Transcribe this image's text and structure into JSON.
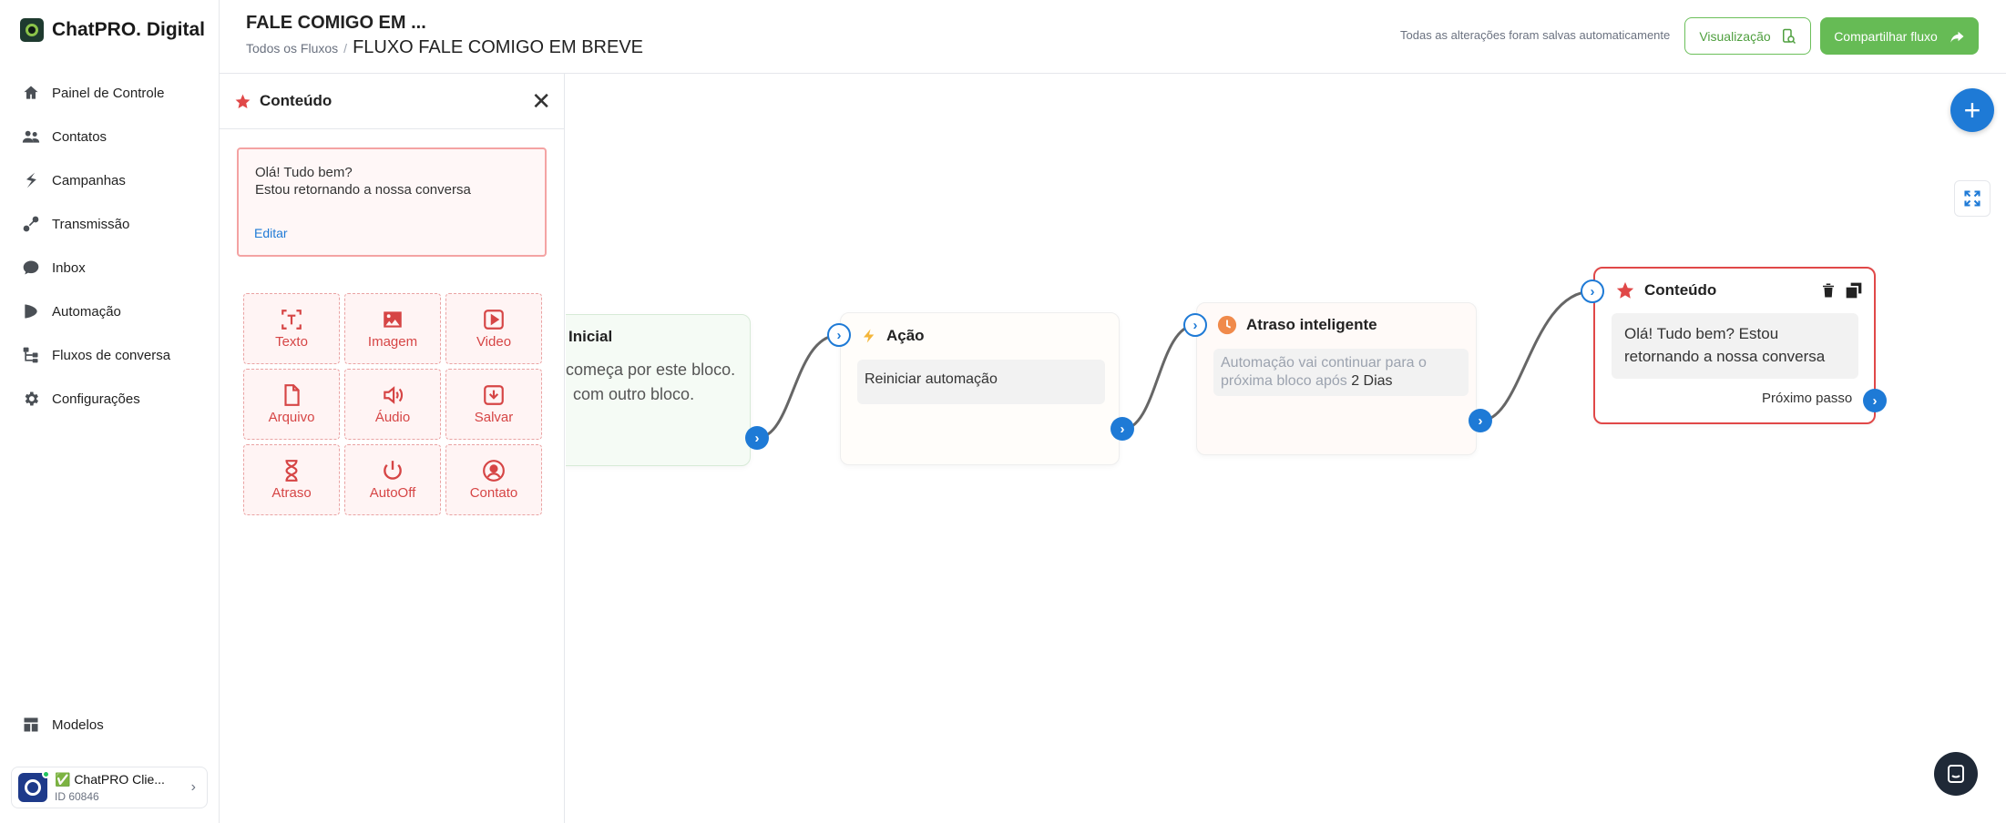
{
  "brand": {
    "name": "ChatPRO. Digital"
  },
  "sidebar": {
    "items": [
      {
        "label": "Painel de Controle",
        "icon": "home-icon"
      },
      {
        "label": "Contatos",
        "icon": "users-icon"
      },
      {
        "label": "Campanhas",
        "icon": "campaign-icon"
      },
      {
        "label": "Transmissão",
        "icon": "broadcast-icon"
      },
      {
        "label": "Inbox",
        "icon": "chat-bubble-icon"
      },
      {
        "label": "Automação",
        "icon": "automation-icon"
      },
      {
        "label": "Fluxos de conversa",
        "icon": "flow-icon"
      },
      {
        "label": "Configurações",
        "icon": "gear-icon"
      }
    ],
    "bottom_item": {
      "label": "Modelos",
      "icon": "templates-icon"
    },
    "account": {
      "name": "✅ ChatPRO Clie...",
      "id": "ID 60846"
    }
  },
  "header": {
    "title": "FALE COMIGO EM ...",
    "breadcrumb_root": "Todos os Fluxos",
    "breadcrumb_sep": "/",
    "breadcrumb_current": "FLUXO FALE COMIGO EM BREVE",
    "saved_status": "Todas as alterações foram salvas automaticamente",
    "preview_label": "Visualização",
    "share_label": "Compartilhar fluxo"
  },
  "panel": {
    "title": "Conteúdo",
    "message_lines": [
      "Olá! Tudo bem?",
      "Estou retornando a nossa conversa"
    ],
    "edit_label": "Editar",
    "tiles": [
      {
        "label": "Texto",
        "icon": "text-icon"
      },
      {
        "label": "Imagem",
        "icon": "image-icon"
      },
      {
        "label": "Video",
        "icon": "video-icon"
      },
      {
        "label": "Arquivo",
        "icon": "file-icon"
      },
      {
        "label": "Áudio",
        "icon": "audio-icon"
      },
      {
        "label": "Salvar",
        "icon": "save-icon"
      },
      {
        "label": "Atraso",
        "icon": "clock-icon"
      },
      {
        "label": "AutoOff",
        "icon": "power-icon"
      },
      {
        "label": "Contato",
        "icon": "contact-icon"
      }
    ]
  },
  "canvas": {
    "start_node": {
      "title": "Inicial",
      "text_line1": "começa por este bloco.",
      "text_line2": "com outro bloco."
    },
    "action_node": {
      "title": "Ação",
      "pill": "Reiniciar automação"
    },
    "delay_node": {
      "title": "Atraso inteligente",
      "text_prefix": "Automação vai continuar para o próxima bloco após",
      "text_value": "2 Dias"
    },
    "content_node": {
      "title": "Conteúdo",
      "message": "Olá! Tudo bem? Estou retornando a nossa conversa",
      "next_step": "Próximo passo"
    }
  },
  "colors": {
    "accent": "#1e7ad6",
    "green": "#66bb55",
    "red": "#d64545"
  }
}
